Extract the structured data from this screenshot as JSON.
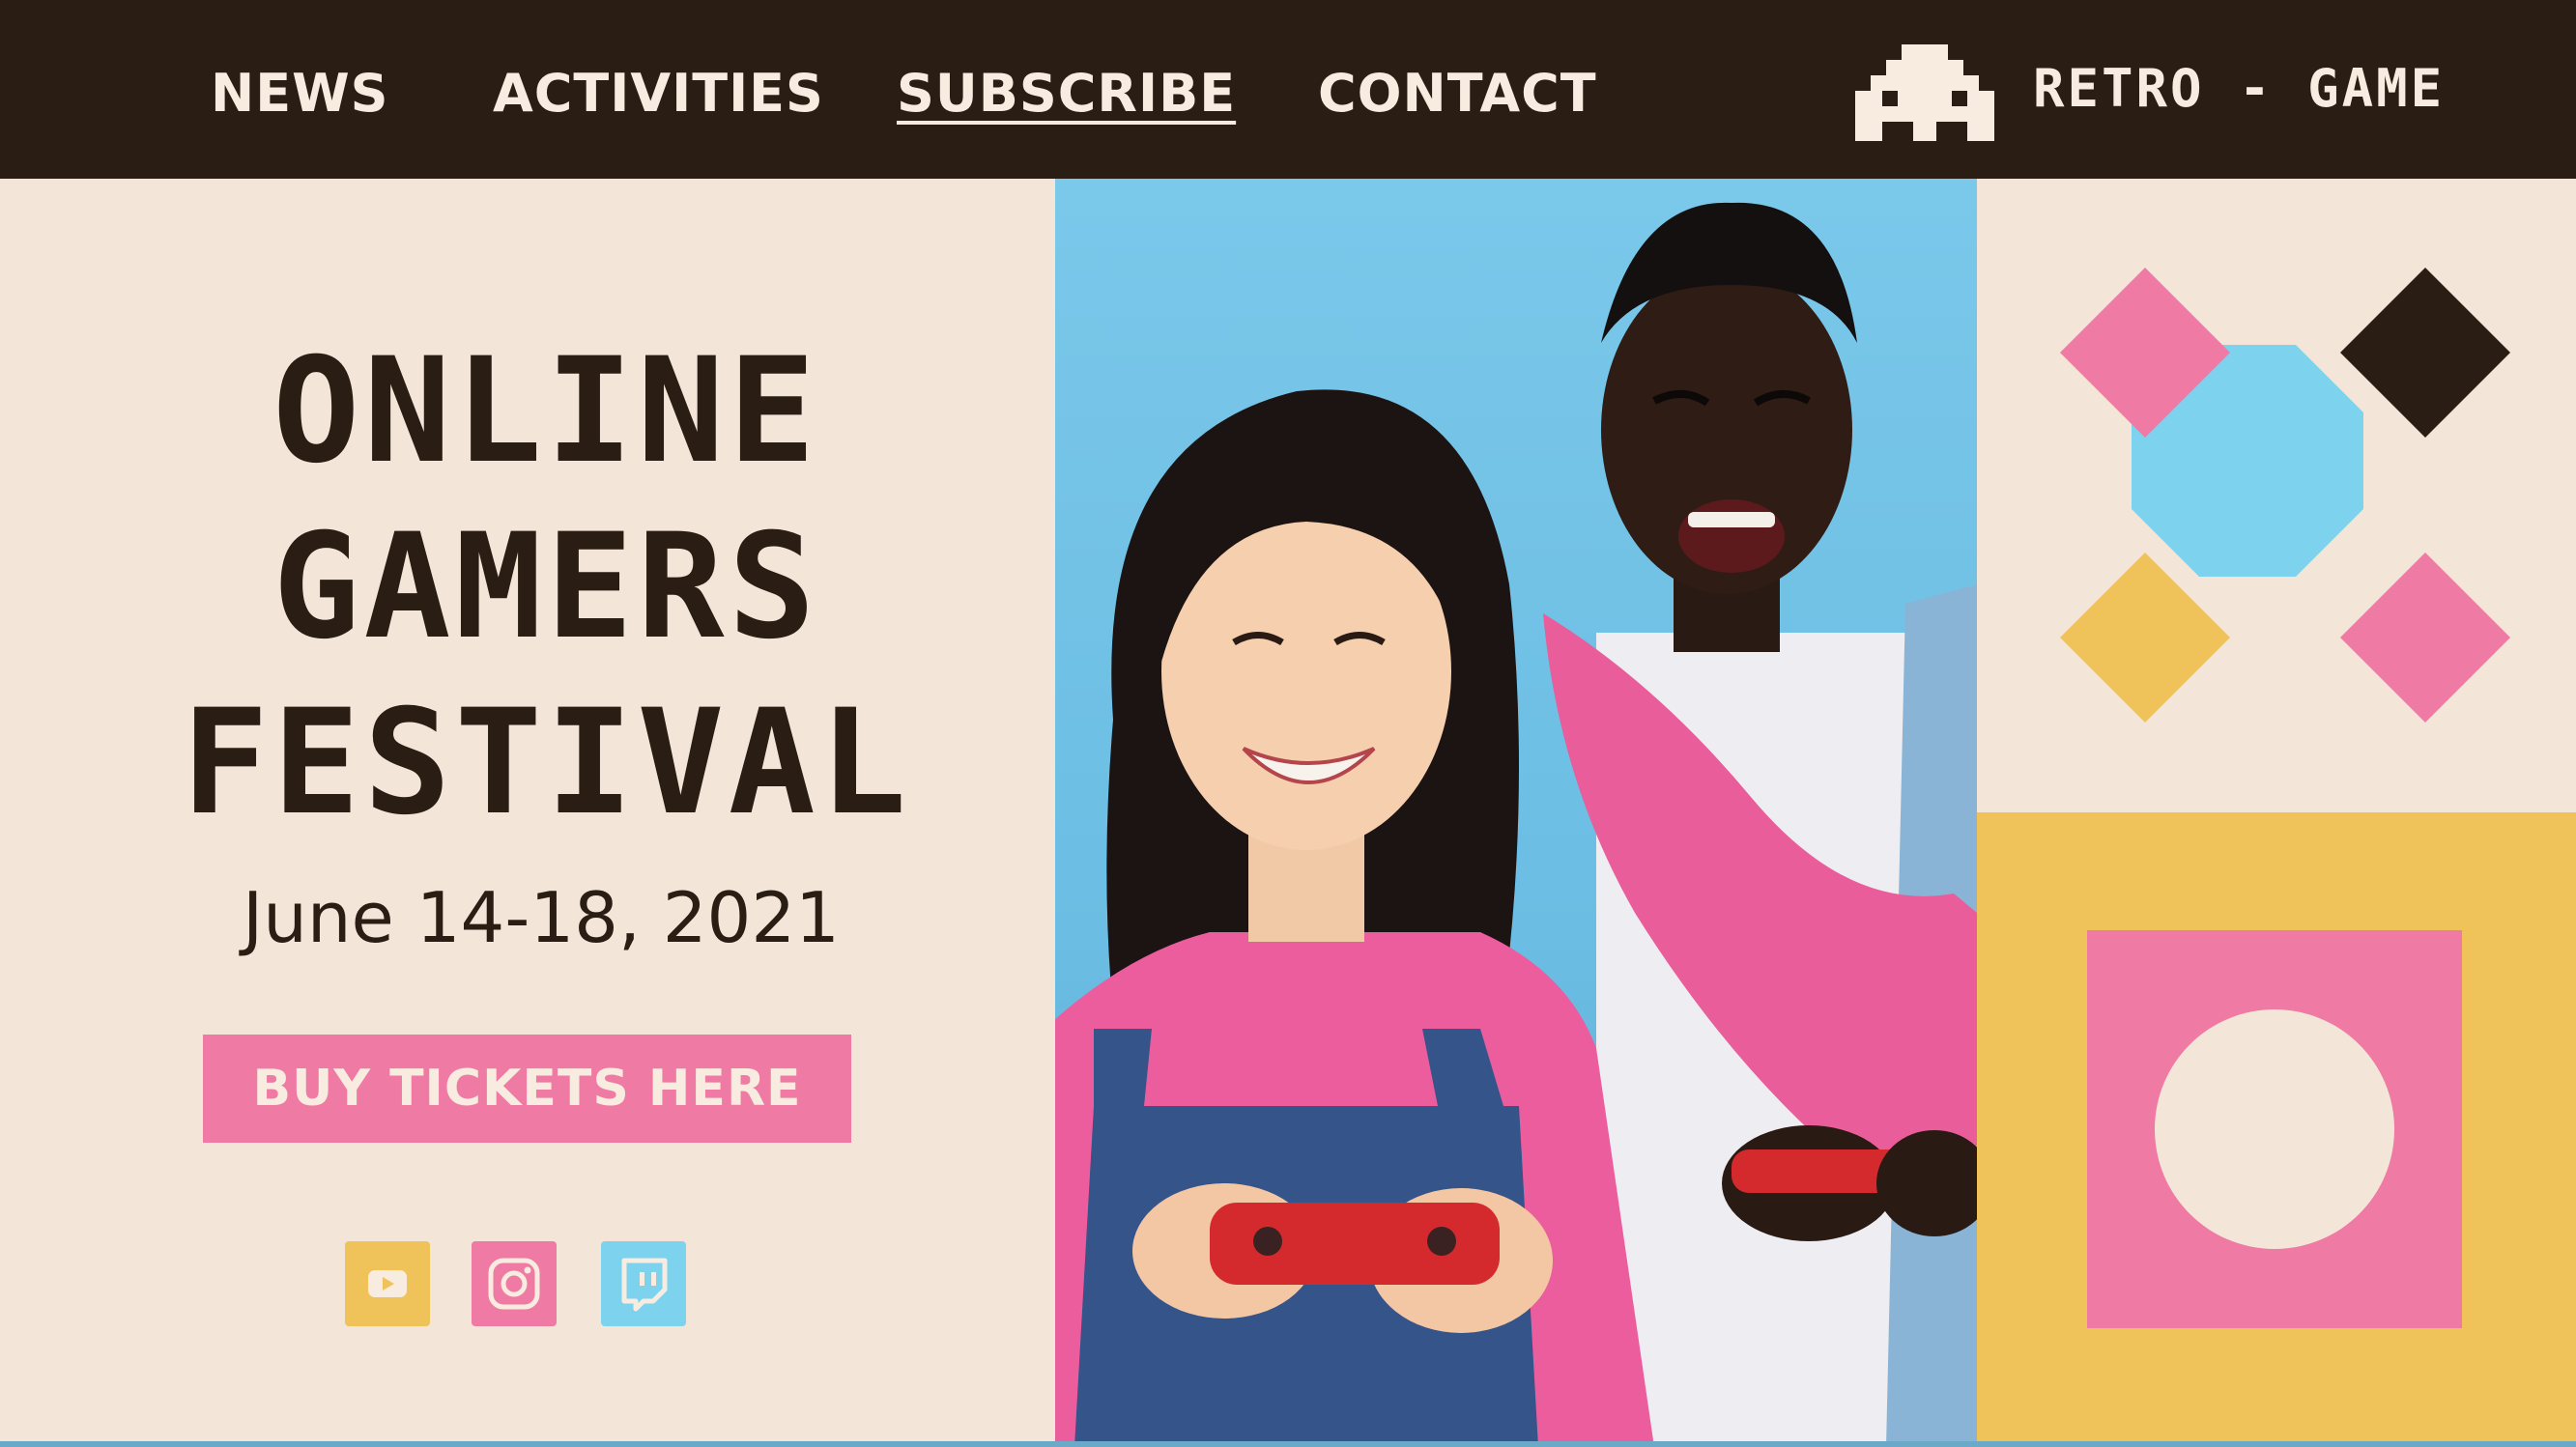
{
  "nav": {
    "items": [
      {
        "label": "NEWS"
      },
      {
        "label": "ACTIVITIES"
      },
      {
        "label": "SUBSCRIBE",
        "active": true
      },
      {
        "label": "CONTACT"
      }
    ]
  },
  "brand": {
    "name": "RETRO - GAME",
    "logo_icon": "space-invader-icon"
  },
  "hero": {
    "title_lines": [
      "ONLINE",
      "GAMERS",
      "FESTIVAL"
    ],
    "date": "June 14-18, 2021",
    "cta_label": "BUY TICKETS HERE"
  },
  "social": [
    {
      "name": "youtube-icon",
      "color": "#f0c35a"
    },
    {
      "name": "instagram-icon",
      "color": "#ef7aa3"
    },
    {
      "name": "twitch-icon",
      "color": "#7dd3ee"
    }
  ],
  "colors": {
    "navbar_bg": "#2a1d13",
    "cream": "#f3e6d8",
    "pink": "#ef7aa3",
    "yellow": "#f0c35a",
    "blue": "#7dd3ee",
    "dark": "#2a1d13"
  }
}
